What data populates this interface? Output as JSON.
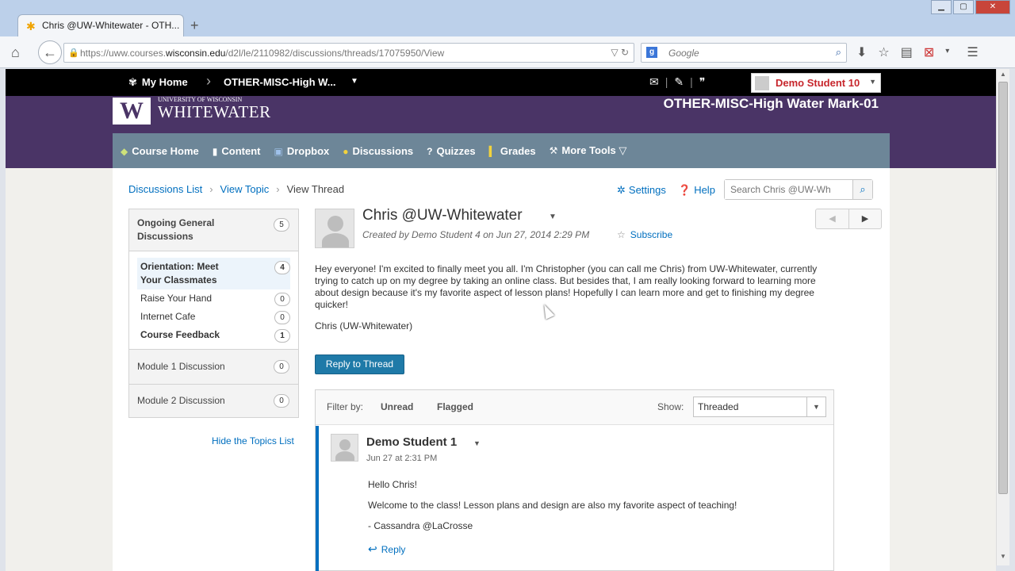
{
  "browser": {
    "tab_title": "Chris @UW-Whitewater - OTH...",
    "new_tab": "+",
    "url_prefix": "https://uww.courses.",
    "url_domain": "wisconsin.edu",
    "url_path": "/d2l/le/2110982/discussions/threads/17075950/View",
    "search_placeholder": "Google",
    "search_engine_icon": "g"
  },
  "d2l": {
    "my_home": "My Home",
    "course_short": "OTHER-MISC-High W...",
    "user_name": "Demo Student 10"
  },
  "banner": {
    "logo_university": "UNIVERSITY OF WISCONSIN",
    "logo_name": "WHITEWATER",
    "course_title": "OTHER-MISC-High Water Mark-01"
  },
  "course_nav": [
    {
      "label": "Course Home",
      "icon": "home-icon"
    },
    {
      "label": "Content",
      "icon": "book-icon"
    },
    {
      "label": "Dropbox",
      "icon": "dropbox-icon"
    },
    {
      "label": "Discussions",
      "icon": "discussions-icon"
    },
    {
      "label": "Quizzes",
      "icon": "quiz-icon"
    },
    {
      "label": "Grades",
      "icon": "grades-icon"
    },
    {
      "label": "More Tools",
      "icon": "tools-icon"
    }
  ],
  "breadcrumbs": [
    "Discussions List",
    "View Topic",
    "View Thread"
  ],
  "toolbar": {
    "settings": "Settings",
    "help": "Help",
    "search_placeholder": "Search Chris @UW-Wh"
  },
  "topics": {
    "groups": [
      {
        "title": "Ongoing General Discussions",
        "count": "5"
      },
      {
        "title": "Module 1 Discussion",
        "count": "0"
      },
      {
        "title": "Module 2 Discussion",
        "count": "0"
      }
    ],
    "items": [
      {
        "title": "Orientation: Meet Your Classmates",
        "count": "4"
      },
      {
        "title": "Raise Your Hand",
        "count": "0"
      },
      {
        "title": "Internet Cafe",
        "count": "0"
      },
      {
        "title": "Course Feedback",
        "count": "1"
      }
    ],
    "hide_link": "Hide the Topics List"
  },
  "thread": {
    "title": "Chris @UW-Whitewater",
    "meta": "Created by Demo Student 4 on Jun 27, 2014 2:29 PM",
    "subscribe": "Subscribe",
    "body": "Hey everyone! I'm excited to finally meet you all. I'm Christopher (you can call me Chris) from UW-Whitewater, currently trying to catch up on my degree by taking an online class. But besides that, I am really looking forward to learning more about design because it's my favorite aspect of lesson plans! Hopefully I can learn more and get to finishing my degree quicker!",
    "signature": "Chris (UW-Whitewater)",
    "reply_button": "Reply to Thread"
  },
  "filter": {
    "label": "Filter by:",
    "unread": "Unread",
    "flagged": "Flagged",
    "show_label": "Show:",
    "show_value": "Threaded"
  },
  "post": {
    "author": "Demo Student 1",
    "time": "Jun 27 at 2:31 PM",
    "line1": "Hello Chris!",
    "line2": "Welcome to the class! Lesson plans and design are also my favorite aspect of teaching!",
    "line3": "- Cassandra @LaCrosse",
    "reply": "Reply"
  },
  "colors": {
    "banner_purple": "#4a3466",
    "nav_slate": "#6d8698",
    "link_blue": "#006fbf",
    "button_blue": "#1f7aa8",
    "user_red": "#c7262c"
  }
}
